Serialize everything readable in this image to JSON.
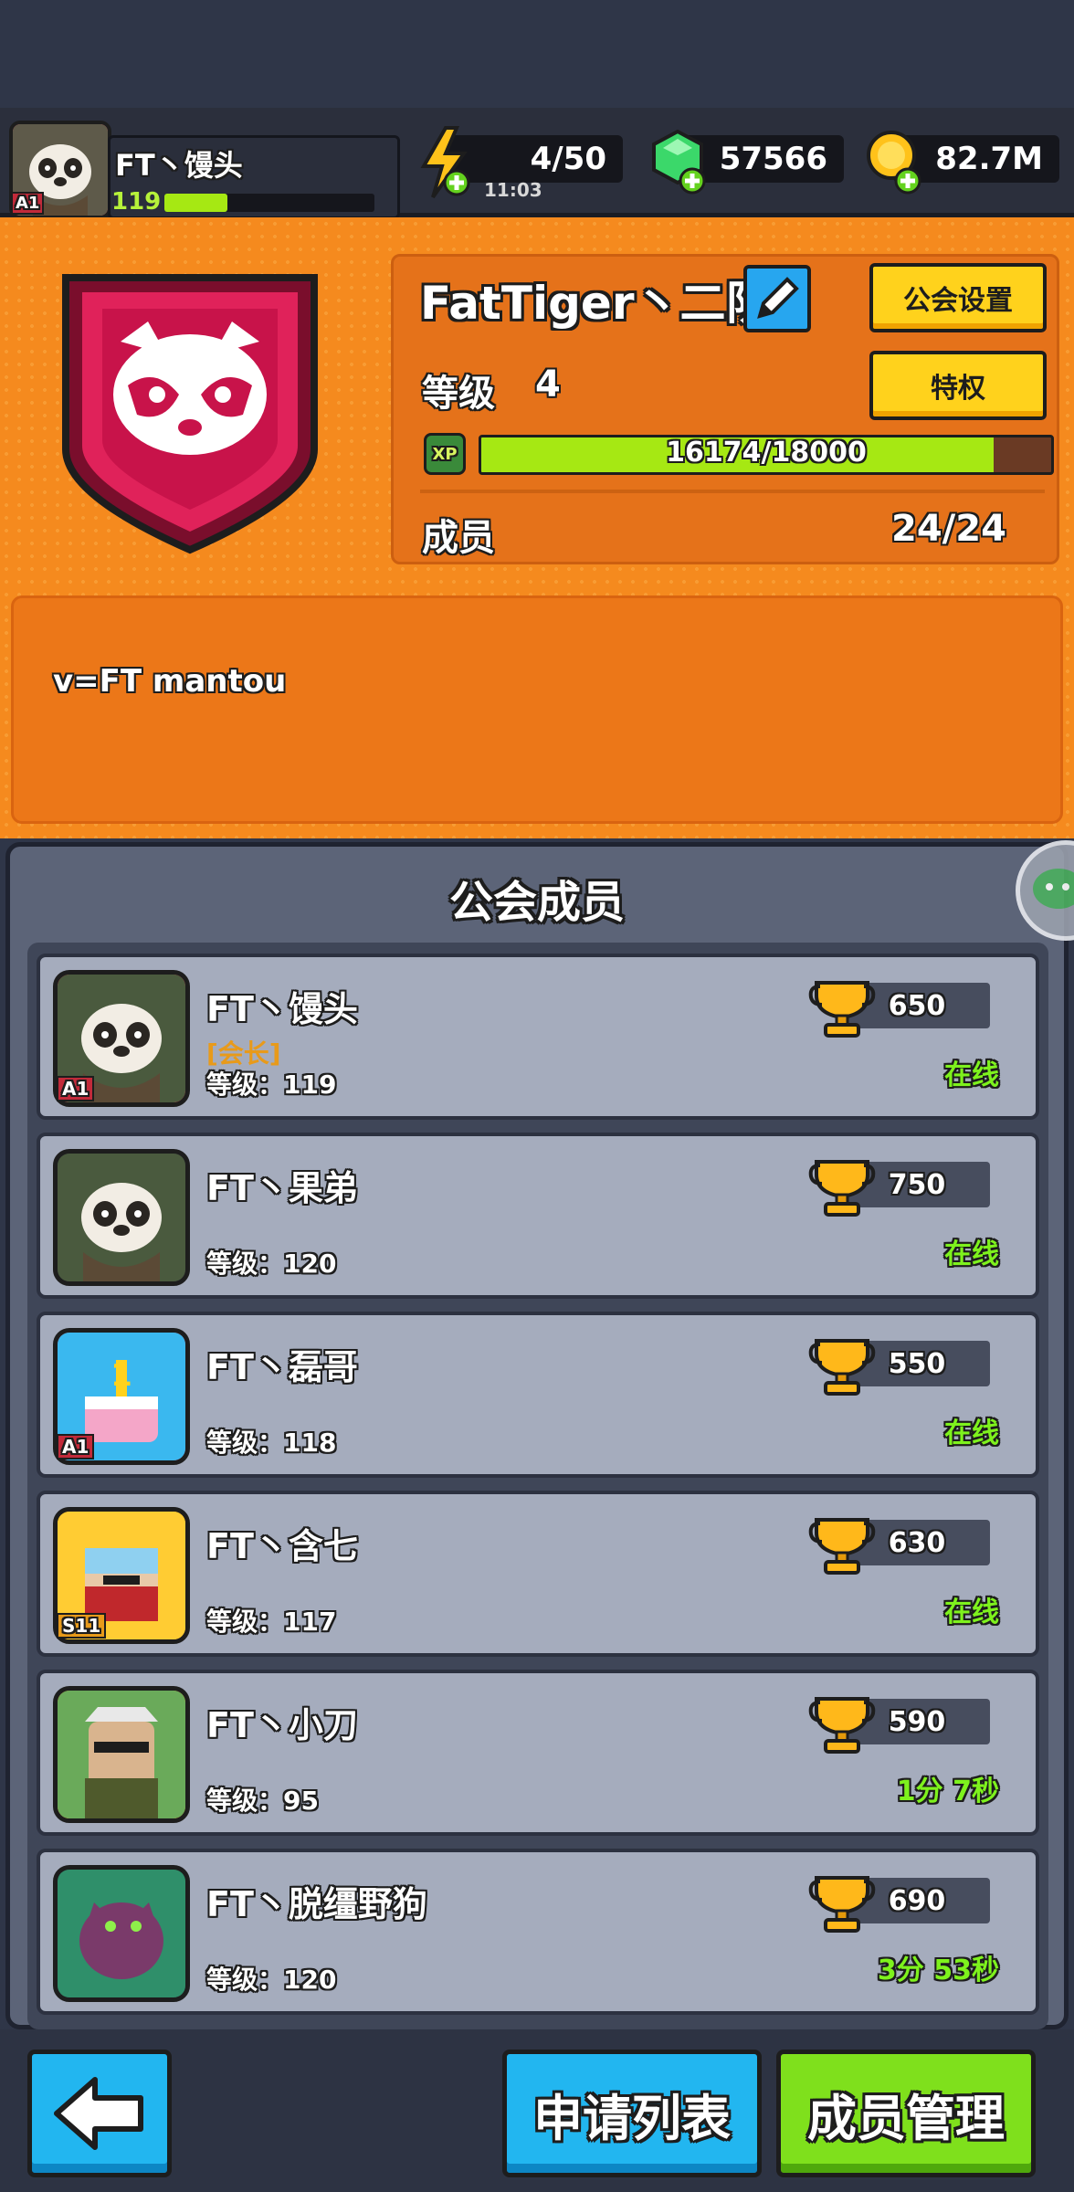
{
  "player": {
    "name": "FT丶馒头",
    "level": "119",
    "badge": "A1",
    "xp_fraction": 0.3
  },
  "resources": {
    "energy": "4/50",
    "energy_timer": "11:03",
    "gems": "57566",
    "coins": "82.7M"
  },
  "guild": {
    "name": "FatTiger丶二队",
    "settings_label": "公会设置",
    "privilege_label": "特权",
    "level_label": "等级",
    "level": "4",
    "xp_label": "XP",
    "xp_text": "16174/18000",
    "xp_fraction": 0.8986,
    "members_label": "成员",
    "members_count": "24/24",
    "description": "v=FT mantou",
    "emblem_icon": "raccoon-icon",
    "colors": {
      "orange": "#f58a1e",
      "emblem": "#e0225a",
      "bar_green": "#a6e813"
    }
  },
  "members_section": {
    "title": "公会成员",
    "level_prefix": "等级：",
    "items": [
      {
        "name": "FT丶馒头",
        "role": "[会长]",
        "level": "119",
        "trophies": "650",
        "status": "在线",
        "badge": "A1",
        "avatar": "panda-avatar",
        "frame": "red"
      },
      {
        "name": "FT丶果弟",
        "role": "",
        "level": "120",
        "trophies": "750",
        "status": "在线",
        "badge": "",
        "avatar": "panda-avatar",
        "frame": "dark"
      },
      {
        "name": "FT丶磊哥",
        "role": "",
        "level": "118",
        "trophies": "550",
        "status": "在线",
        "badge": "A1",
        "avatar": "cake-avatar",
        "frame": "red"
      },
      {
        "name": "FT丶含七",
        "role": "",
        "level": "117",
        "trophies": "630",
        "status": "在线",
        "badge": "S11",
        "avatar": "goggles-avatar",
        "frame": "gold"
      },
      {
        "name": "FT丶小刀",
        "role": "",
        "level": "95",
        "trophies": "590",
        "status": "1分 7秒",
        "badge": "",
        "avatar": "soldier-avatar",
        "frame": "orange"
      },
      {
        "name": "FT丶脱缰野狗",
        "role": "",
        "level": "120",
        "trophies": "690",
        "status": "3分 53秒",
        "badge": "",
        "avatar": "monster-avatar",
        "frame": "dark"
      }
    ]
  },
  "bottom": {
    "back_icon": "arrow-left-icon",
    "apply_list_label": "申请列表",
    "member_manage_label": "成员管理"
  }
}
